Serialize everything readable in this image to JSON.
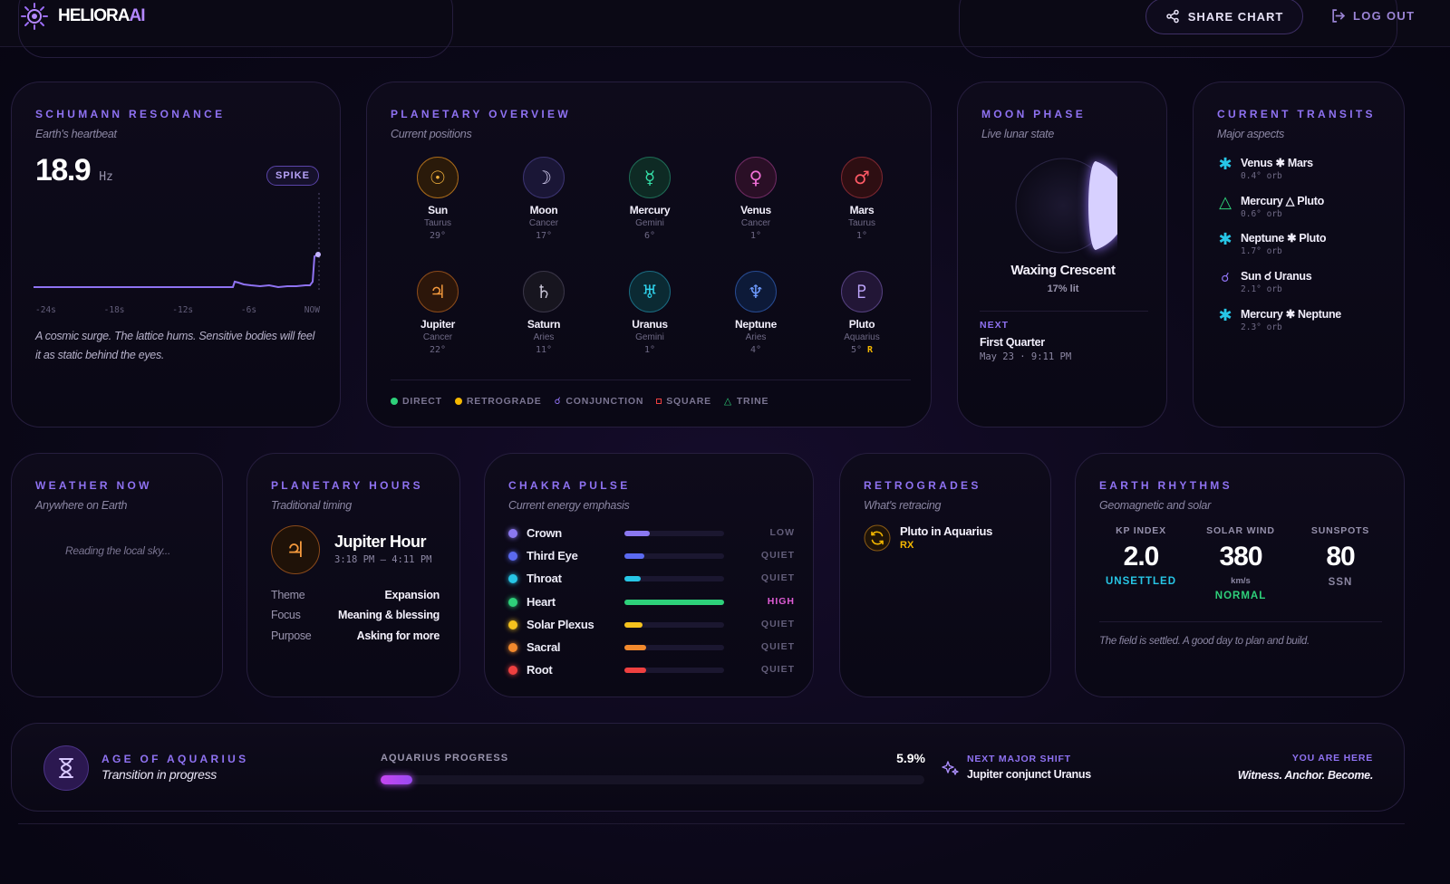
{
  "brand": {
    "name_main": "HELIORA",
    "name_ai": "AI",
    "logo_icon": "sun-logo-icon"
  },
  "header": {
    "share_label": "SHARE CHART",
    "logout_label": "LOG OUT"
  },
  "colors": {
    "accent": "#8f72f2",
    "cyan": "#27c6e6",
    "green": "#2ed07a",
    "orange": "#f29a36",
    "pink": "#e05cd6"
  },
  "schumann": {
    "title": "SCHUMANN RESONANCE",
    "subtitle": "Earth's heartbeat",
    "value": "18.9",
    "unit": "Hz",
    "badge": "SPIKE",
    "axis_labels": [
      "-24s",
      "-18s",
      "-12s",
      "-6s",
      "NOW"
    ],
    "caption": "A cosmic surge. The lattice hums. Sensitive bodies will feel it as static behind the eyes."
  },
  "planetary": {
    "title": "PLANETARY OVERVIEW",
    "subtitle": "Current positions",
    "planets": [
      {
        "name": "Sun",
        "sign": "Taurus",
        "deg": "29°",
        "glyph": "☉",
        "icon": "sun-icon"
      },
      {
        "name": "Moon",
        "sign": "Cancer",
        "deg": "17°",
        "glyph": "☽",
        "icon": "moon-icon"
      },
      {
        "name": "Mercury",
        "sign": "Gemini",
        "deg": "6°",
        "glyph": "☿",
        "icon": "mercury-icon"
      },
      {
        "name": "Venus",
        "sign": "Cancer",
        "deg": "1°",
        "glyph": "♀",
        "icon": "venus-icon"
      },
      {
        "name": "Mars",
        "sign": "Taurus",
        "deg": "1°",
        "glyph": "♂",
        "icon": "mars-icon"
      },
      {
        "name": "Jupiter",
        "sign": "Cancer",
        "deg": "22°",
        "glyph": "♃",
        "icon": "jupiter-icon"
      },
      {
        "name": "Saturn",
        "sign": "Aries",
        "deg": "11°",
        "glyph": "♄",
        "icon": "saturn-icon"
      },
      {
        "name": "Uranus",
        "sign": "Gemini",
        "deg": "1°",
        "glyph": "♅",
        "icon": "uranus-icon"
      },
      {
        "name": "Neptune",
        "sign": "Aries",
        "deg": "4°",
        "glyph": "♆",
        "icon": "neptune-icon"
      },
      {
        "name": "Pluto",
        "sign": "Aquarius",
        "deg": "5°",
        "retro": "R",
        "glyph": "♇",
        "icon": "pluto-icon"
      }
    ],
    "legend": {
      "direct": "DIRECT",
      "retrograde": "RETROGRADE",
      "conjunction": "CONJUNCTION",
      "square": "SQUARE",
      "trine": "TRINE"
    }
  },
  "moon": {
    "title": "MOON PHASE",
    "subtitle": "Live lunar state",
    "phase": "Waxing Crescent",
    "illum": "17% lit",
    "next_label": "NEXT",
    "next_phase": "First Quarter",
    "next_time": "May 23 · 9:11 PM"
  },
  "transits": {
    "title": "CURRENT TRANSITS",
    "subtitle": "Major aspects",
    "items": [
      {
        "text": "Venus ✱ Mars",
        "orb": "0.4° orb",
        "glyph": "✱",
        "icon": "sextile-icon"
      },
      {
        "text": "Mercury △ Pluto",
        "orb": "0.6° orb",
        "glyph": "△",
        "icon": "trine-icon"
      },
      {
        "text": "Neptune ✱ Pluto",
        "orb": "1.7° orb",
        "glyph": "✱",
        "icon": "sextile-icon"
      },
      {
        "text": "Sun ☌ Uranus",
        "orb": "2.1° orb",
        "glyph": "☌",
        "icon": "conjunction-icon"
      },
      {
        "text": "Mercury ✱ Neptune",
        "orb": "2.3° orb",
        "glyph": "✱",
        "icon": "sextile-icon"
      }
    ]
  },
  "weather": {
    "title": "WEATHER NOW",
    "subtitle": "Anywhere on Earth",
    "status": "Reading the local sky..."
  },
  "hours": {
    "title": "PLANETARY HOURS",
    "subtitle": "Traditional timing",
    "hour": "Jupiter Hour",
    "time": "3:18 PM – 4:11 PM",
    "glyph": "♃",
    "rows": [
      {
        "key": "Theme",
        "value": "Expansion"
      },
      {
        "key": "Focus",
        "value": "Meaning & blessing"
      },
      {
        "key": "Purpose",
        "value": "Asking for more"
      }
    ]
  },
  "chakra": {
    "title": "CHAKRA PULSE",
    "subtitle": "Current energy emphasis",
    "items": [
      {
        "name": "Crown",
        "level": "LOW",
        "fill": 0.25,
        "color": "#8b78f0"
      },
      {
        "name": "Third Eye",
        "level": "QUIET",
        "fill": 0.2,
        "color": "#5b6af0"
      },
      {
        "name": "Throat",
        "level": "QUIET",
        "fill": 0.16,
        "color": "#27c6e6"
      },
      {
        "name": "Heart",
        "level": "HIGH",
        "fill": 1.0,
        "color": "#2ed07a"
      },
      {
        "name": "Solar Plexus",
        "level": "QUIET",
        "fill": 0.18,
        "color": "#f5c21d"
      },
      {
        "name": "Sacral",
        "level": "QUIET",
        "fill": 0.22,
        "color": "#f2892d"
      },
      {
        "name": "Root",
        "level": "QUIET",
        "fill": 0.22,
        "color": "#ef4040"
      }
    ]
  },
  "retrogrades": {
    "title": "RETROGRADES",
    "subtitle": "What's retracing",
    "items": [
      {
        "text": "Pluto in Aquarius",
        "tag": "RX"
      }
    ]
  },
  "earth": {
    "title": "EARTH RHYTHMS",
    "subtitle": "Geomagnetic and solar",
    "kp_label": "KP INDEX",
    "kp_value": "2.0",
    "kp_status": "UNSETTLED",
    "wind_label": "SOLAR WIND",
    "wind_value": "380",
    "wind_unit": "km/s",
    "wind_status": "NORMAL",
    "spots_label": "SUNSPOTS",
    "spots_value": "80",
    "spots_unit": "SSN",
    "note": "The field is settled. A good day to plan and build."
  },
  "aquarius": {
    "title": "AGE OF AQUARIUS",
    "subtitle": "Transition in progress",
    "progress_label": "AQUARIUS PROGRESS",
    "progress_value": "5.9%",
    "progress": 0.059,
    "next_label": "NEXT MAJOR SHIFT",
    "next_value": "Jupiter conjunct Uranus",
    "here_label": "YOU ARE HERE",
    "motto": "Witness. Anchor. Become."
  }
}
